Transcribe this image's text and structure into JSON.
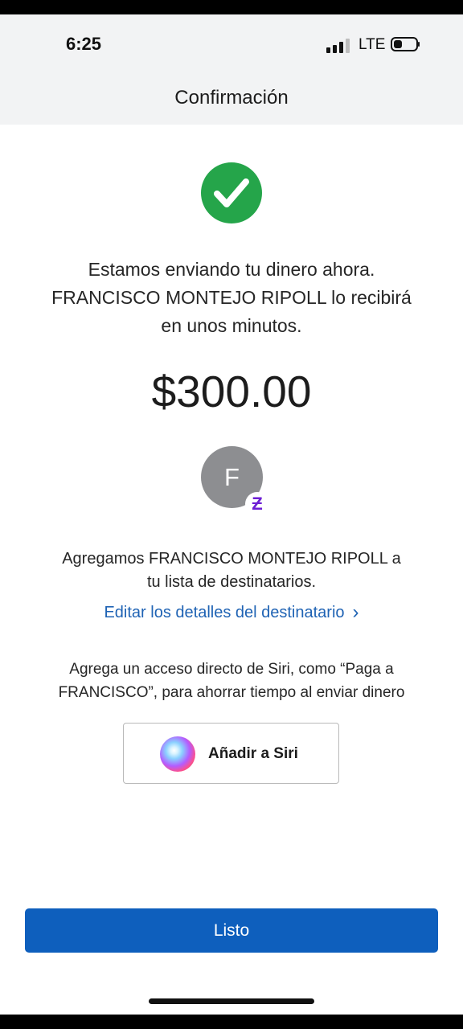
{
  "status_bar": {
    "time": "6:25",
    "network": "LTE"
  },
  "header": {
    "title": "Confirmación"
  },
  "confirmation": {
    "message_lines": [
      "Estamos enviando tu dinero ahora.",
      "FRANCISCO MONTEJO RIPOLL lo recibirá",
      "en unos minutos."
    ],
    "amount": "$300.00"
  },
  "recipient": {
    "initial": "F",
    "badge": "Ƶ",
    "added_lines": [
      "Agregamos FRANCISCO MONTEJO RIPOLL a",
      "tu lista de destinatarios."
    ],
    "edit_link": "Editar los detalles del destinatario",
    "edit_chevron": "›"
  },
  "siri": {
    "text_lines": [
      "Agrega un acceso directo de Siri, como “Paga a",
      "FRANCISCO”, para ahorrar tiempo al enviar dinero"
    ],
    "button_label": "Añadir a Siri"
  },
  "footer": {
    "done_label": "Listo"
  },
  "colors": {
    "success_green": "#25a54a",
    "link_blue": "#1f63b4",
    "primary_button": "#0e5fbd",
    "zelle_purple": "#6d1ed4"
  }
}
